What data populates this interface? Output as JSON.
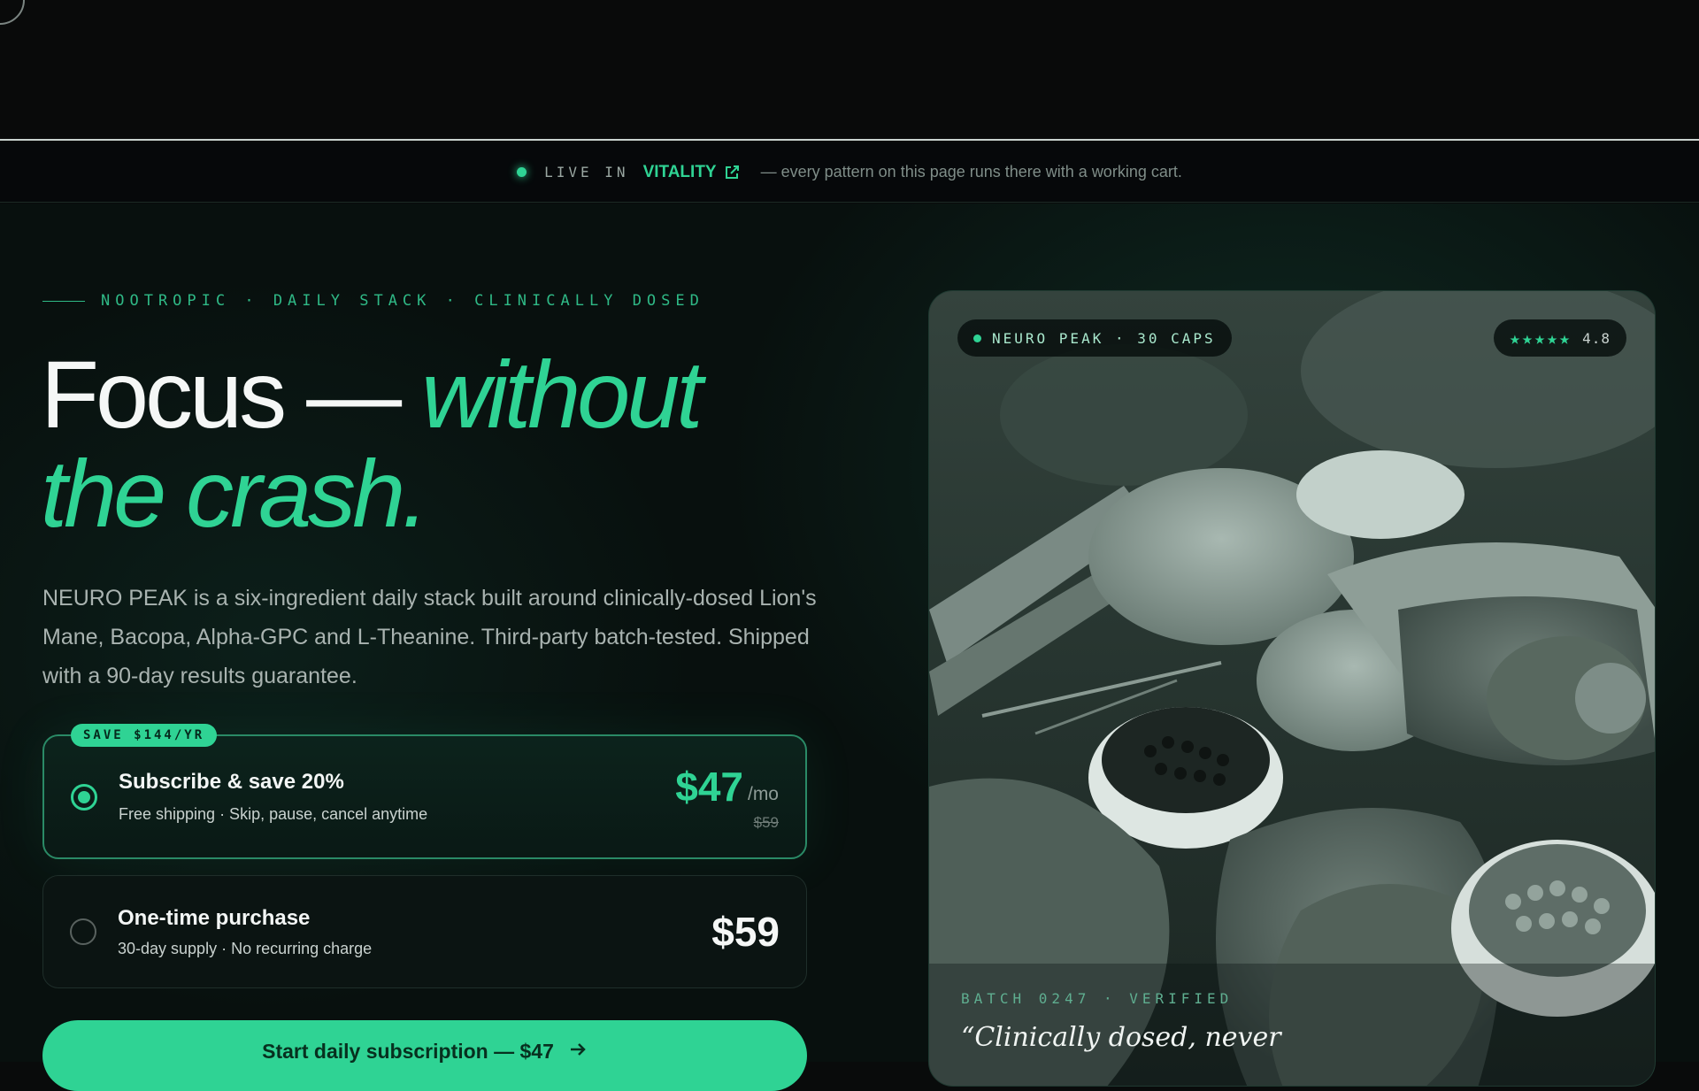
{
  "live_bar": {
    "live_in": "LIVE IN",
    "brand": "VITALITY",
    "tail": "— every pattern on this page runs there with a working cart."
  },
  "hero": {
    "eyebrow": "NOOTROPIC · DAILY STACK · CLINICALLY DOSED",
    "headline_plain": "Focus — ",
    "headline_accent_1": "without",
    "headline_accent_2": "the crash.",
    "lede": "NEURO PEAK is a six-ingredient daily stack built around clinically-dosed Lion's Mane, Bacopa, Alpha-GPC and L-Theanine. Third-party batch-tested. Shipped with a 90-day results guarantee."
  },
  "options": {
    "subscribe": {
      "badge": "SAVE $144/YR",
      "title": "Subscribe & save 20%",
      "subtitle": "Free shipping · Skip, pause, cancel anytime",
      "price": "$47",
      "per": "/mo",
      "strike": "$59",
      "selected": true
    },
    "one_time": {
      "title": "One-time purchase",
      "subtitle": "30-day supply · No recurring charge",
      "price": "$59",
      "selected": false
    }
  },
  "cta": {
    "label": "Start daily subscription — $47",
    "icon": "arrow-right-icon"
  },
  "product_card": {
    "tag": "NEURO PEAK · 30 CAPS",
    "rating": "4.8",
    "stars": "★★★★★",
    "batch": "BATCH 0247 · VERIFIED",
    "quote": "“Clinically dosed, never"
  },
  "colors": {
    "accent": "#2fd394",
    "background": "#090b0b"
  }
}
